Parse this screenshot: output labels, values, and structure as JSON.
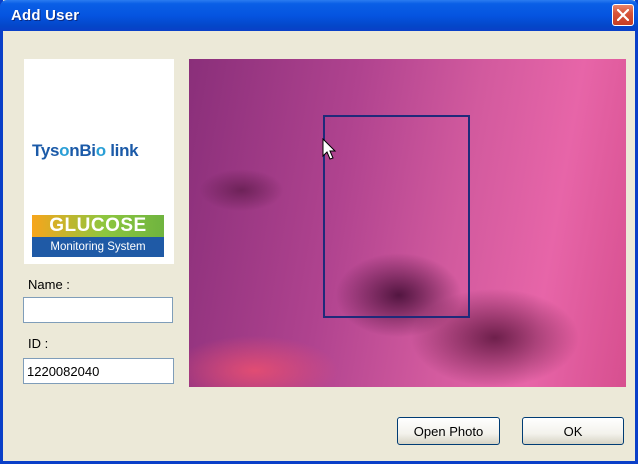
{
  "window": {
    "title": "Add User"
  },
  "titlebar": {
    "close_icon": "close-icon"
  },
  "logo": {
    "brand_part1": "Tys",
    "brand_o": "o",
    "brand_part2": "nBi",
    "brand_o2": "o",
    "brand_part3": " link",
    "glucose_title": "GLUCOSE",
    "glucose_subtitle": "Monitoring System"
  },
  "form": {
    "name_label": "Name :",
    "name_value": "",
    "id_label": "ID :",
    "id_value": "1220082040"
  },
  "buttons": {
    "open_photo": "Open Photo",
    "ok": "OK"
  }
}
